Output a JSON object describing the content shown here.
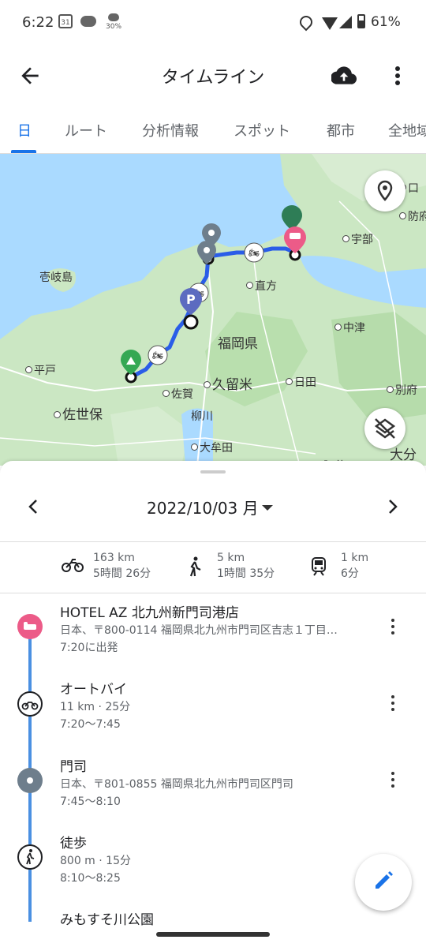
{
  "status_bar": {
    "time": "6:22",
    "calendar_day": "31",
    "rain_pct": "30%",
    "battery_pct": "61%"
  },
  "app_bar": {
    "title": "タイムライン"
  },
  "tabs": [
    {
      "label": "日",
      "active": true
    },
    {
      "label": "ルート"
    },
    {
      "label": "分析情報"
    },
    {
      "label": "スポット"
    },
    {
      "label": "都市"
    },
    {
      "label": "全地域"
    }
  ],
  "map": {
    "labels": {
      "iki": "壱岐島",
      "hirado": "平戸",
      "sasebo": "佐世保",
      "saga": "佐賀",
      "yanagawa": "柳川",
      "omuta": "大牟田",
      "kurume": "久留米",
      "fukuoka_pref": "福岡県",
      "nogata": "直方",
      "nakatsu": "中津",
      "hita": "日田",
      "beppu": "別府",
      "ube": "宇部",
      "hofu": "防府",
      "oita": "大分",
      "top_right": "口",
      "kuju": "阿蘇"
    },
    "parking_label": "P"
  },
  "sheet": {
    "date": "2022/10/03 月",
    "stats": [
      {
        "icon": "motorcycle-icon",
        "distance": "163 km",
        "duration": "5時間 26分"
      },
      {
        "icon": "walk-icon",
        "distance": "5 km",
        "duration": "1時間 35分"
      },
      {
        "icon": "train-icon",
        "distance": "1 km",
        "duration": "6分"
      }
    ],
    "timeline": [
      {
        "type": "place",
        "icon": "hotel-icon",
        "title": "HOTEL AZ 北九州新門司港店",
        "address": "日本、〒800-0114 福岡県北九州市門司区吉志１丁目…",
        "time": "7:20に出発"
      },
      {
        "type": "activity",
        "icon": "motorcycle-icon",
        "title": "オートバイ",
        "detail": "11 km · 25分",
        "time": "7:20〜7:45"
      },
      {
        "type": "place",
        "icon": "place-icon",
        "title": "門司",
        "address": "日本、〒801-0855 福岡県北九州市門司区門司",
        "time": "7:45〜8:10"
      },
      {
        "type": "activity",
        "icon": "walk-icon",
        "title": "徒歩",
        "detail": "800 m · 15分",
        "time": "8:10〜8:25"
      },
      {
        "type": "place",
        "icon": "place-icon",
        "title": "みもすそ川公園"
      }
    ]
  },
  "colors": {
    "accent": "#1a73e8",
    "route": "#2a5de8",
    "hotel": "#ec5b88",
    "camp": "#34a853",
    "timeline": "#4a90e2",
    "place_grey": "#6e7e8c"
  }
}
